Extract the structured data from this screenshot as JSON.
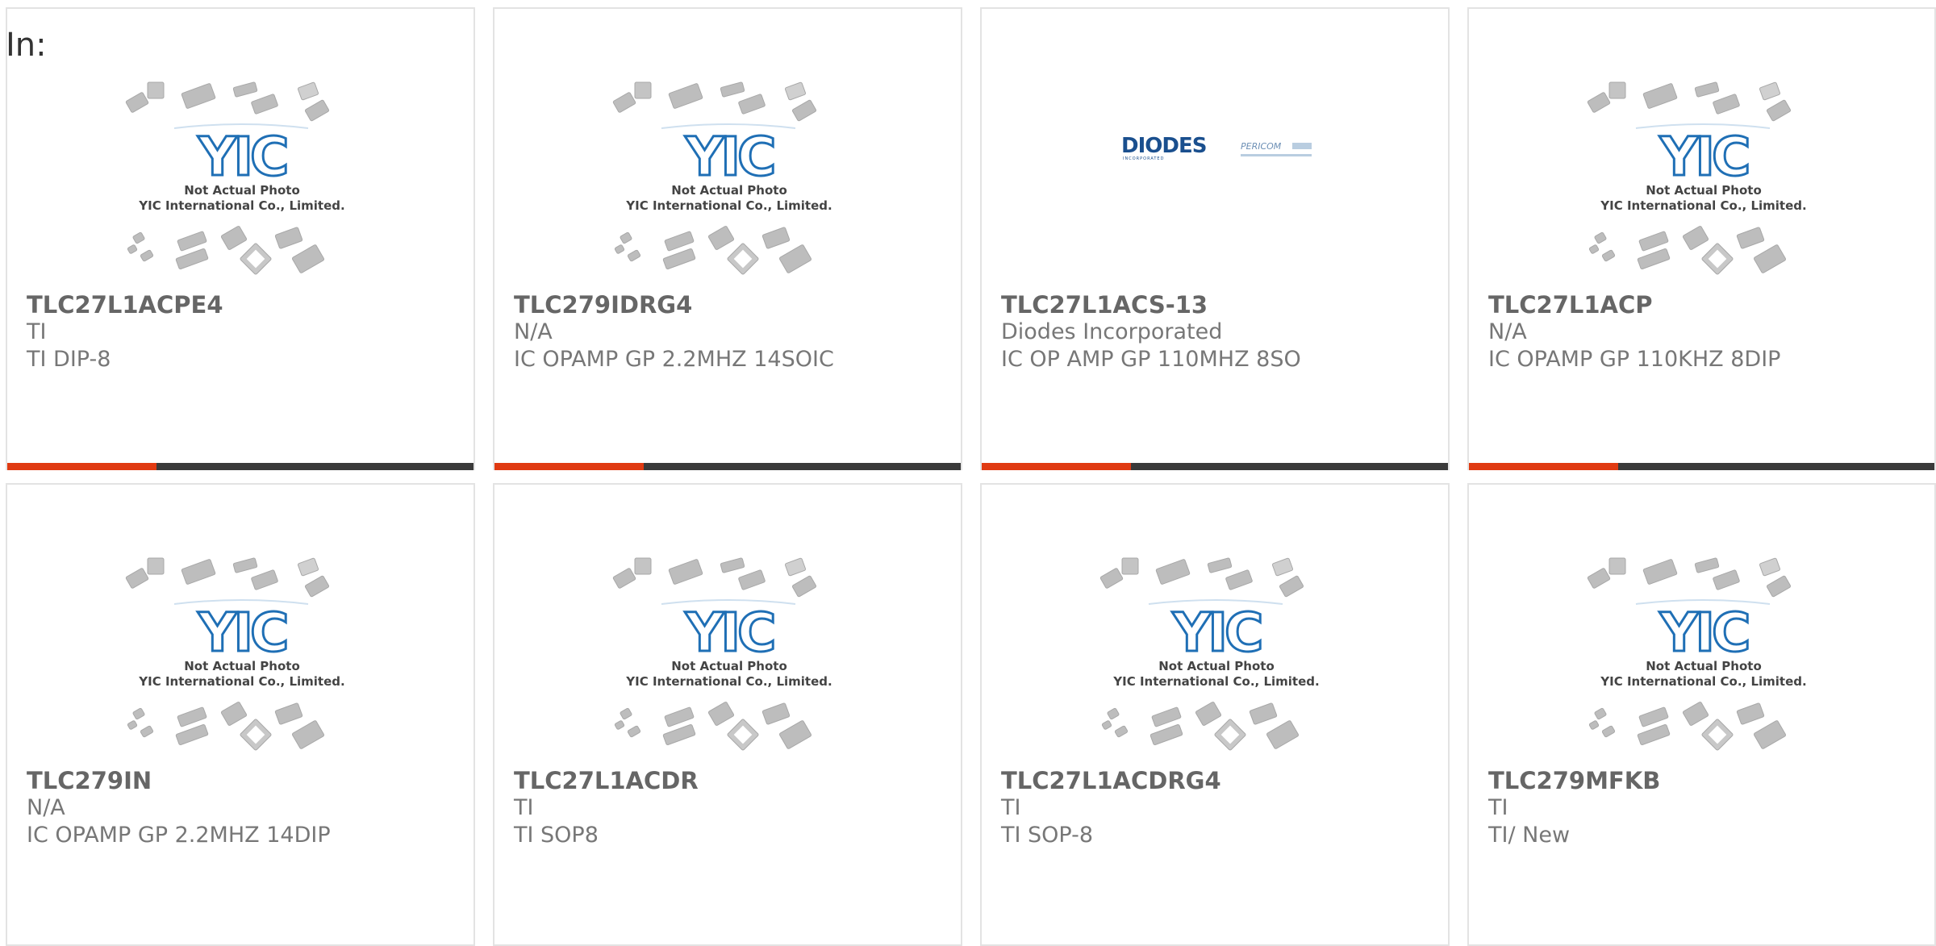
{
  "heading": "In:",
  "thumbnail": {
    "caption_line1": "Not Actual Photo",
    "caption_line2": "YIC International Co., Limited.",
    "logo_text": "YIC"
  },
  "diodes_logo": {
    "brand": "DIODES",
    "sub": "INCORPORATED",
    "partner": "PERICOM"
  },
  "colors": {
    "accent": "#e03a12",
    "bar": "#3a3a3a",
    "logo_blue": "#1f6fb5"
  },
  "products": [
    {
      "part_number": "TLC27L1ACPE4",
      "manufacturer": "TI",
      "description": "TI DIP-8",
      "image": "yic-placeholder",
      "progress": 0.32
    },
    {
      "part_number": "TLC279IDRG4",
      "manufacturer": "N/A",
      "description": "IC OPAMP GP 2.2MHZ 14SOIC",
      "image": "yic-placeholder",
      "progress": 0.32
    },
    {
      "part_number": "TLC27L1ACS-13",
      "manufacturer": "Diodes Incorporated",
      "description": "IC OP AMP GP 110MHZ 8SO",
      "image": "diodes-logo",
      "progress": 0.32
    },
    {
      "part_number": "TLC27L1ACP",
      "manufacturer": "N/A",
      "description": "IC OPAMP GP 110KHZ 8DIP",
      "image": "yic-placeholder",
      "progress": 0.32
    },
    {
      "part_number": "TLC279IN",
      "manufacturer": "N/A",
      "description": "IC OPAMP GP 2.2MHZ 14DIP",
      "image": "yic-placeholder",
      "progress": null
    },
    {
      "part_number": "TLC27L1ACDR",
      "manufacturer": "TI",
      "description": "TI SOP8",
      "image": "yic-placeholder",
      "progress": null
    },
    {
      "part_number": "TLC27L1ACDRG4",
      "manufacturer": "TI",
      "description": "TI SOP-8",
      "image": "yic-placeholder",
      "progress": null
    },
    {
      "part_number": "TLC279MFKB",
      "manufacturer": "TI",
      "description": "TI/ New",
      "image": "yic-placeholder",
      "progress": null
    }
  ]
}
